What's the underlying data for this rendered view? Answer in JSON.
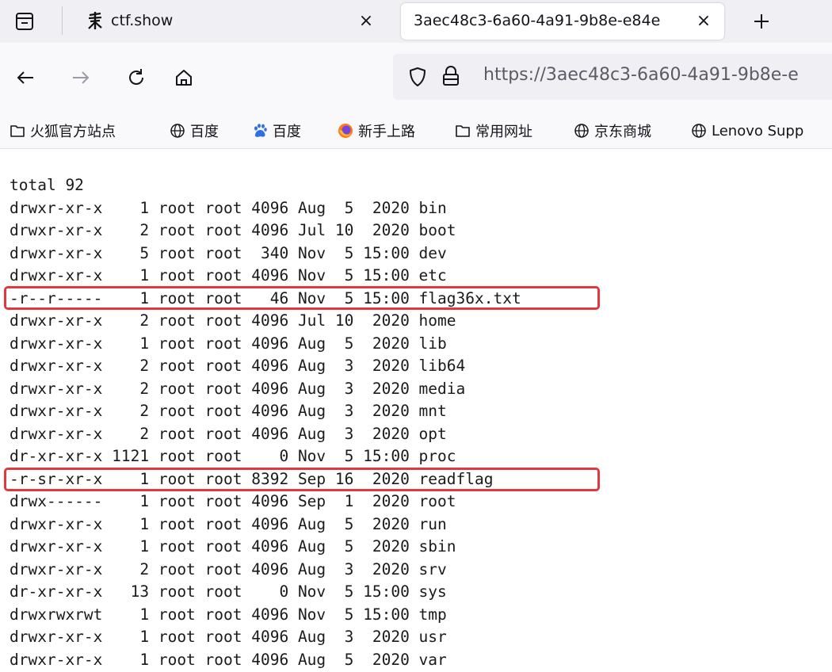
{
  "colors": {
    "tabstrip_bg": "#f0f0f4",
    "toolbar_bg": "#f9f9fb",
    "urlbar_bg": "#f0f0f4",
    "highlight_border": "#e0383e",
    "text": "#15141a",
    "url_text": "#5b5b66"
  },
  "tabs": [
    {
      "title": "ctf.show",
      "active": false,
      "close_glyph": "×",
      "favicon": "ctfshow-logo-icon"
    },
    {
      "title": "3aec48c3-6a60-4a91-9b8e-e84e",
      "active": true,
      "close_glyph": "×"
    }
  ],
  "tabstrip": {
    "new_tab_icon": "plus-icon",
    "list_tabs_icon": "tab-list-icon"
  },
  "navbar": {
    "icons": [
      "back-arrow-icon",
      "forward-arrow-icon",
      "reload-icon",
      "home-icon"
    ],
    "url": "https://3aec48c3-6a60-4a91-9b8e-e",
    "url_icons": [
      "shield-icon",
      "lock-icon"
    ]
  },
  "bookmarks": [
    {
      "label": "火狐官方站点",
      "icon": "folder-icon"
    },
    {
      "label": "百度",
      "icon": "globe-icon"
    },
    {
      "label": "百度",
      "icon": "baidu-paw-icon"
    },
    {
      "label": "新手上路",
      "icon": "firefox-icon"
    },
    {
      "label": "常用网址",
      "icon": "folder-icon"
    },
    {
      "label": "京东商城",
      "icon": "globe-icon"
    },
    {
      "label": "Lenovo Supp",
      "icon": "globe-icon"
    }
  ],
  "listing": {
    "lines": [
      "total 92",
      "drwxr-xr-x    1 root root 4096 Aug  5  2020 bin",
      "drwxr-xr-x    2 root root 4096 Jul 10  2020 boot",
      "drwxr-xr-x    5 root root  340 Nov  5 15:00 dev",
      "drwxr-xr-x    1 root root 4096 Nov  5 15:00 etc",
      "-r--r-----    1 root root   46 Nov  5 15:00 flag36x.txt",
      "drwxr-xr-x    2 root root 4096 Jul 10  2020 home",
      "drwxr-xr-x    1 root root 4096 Aug  5  2020 lib",
      "drwxr-xr-x    2 root root 4096 Aug  3  2020 lib64",
      "drwxr-xr-x    2 root root 4096 Aug  3  2020 media",
      "drwxr-xr-x    2 root root 4096 Aug  3  2020 mnt",
      "drwxr-xr-x    2 root root 4096 Aug  3  2020 opt",
      "dr-xr-xr-x 1121 root root    0 Nov  5 15:00 proc",
      "-r-sr-xr-x    1 root root 8392 Sep 16  2020 readflag",
      "drwx------    1 root root 4096 Sep  1  2020 root",
      "drwxr-xr-x    1 root root 4096 Aug  5  2020 run",
      "drwxr-xr-x    1 root root 4096 Aug  5  2020 sbin",
      "drwxr-xr-x    2 root root 4096 Aug  3  2020 srv",
      "dr-xr-xr-x   13 root root    0 Nov  5 15:00 sys",
      "drwxrwxrwt    1 root root 4096 Nov  5 15:00 tmp",
      "drwxr-xr-x    1 root root 4096 Aug  3  2020 usr",
      "drwxr-xr-x    1 root root 4096 Aug  5  2020 var"
    ],
    "highlighted_entries": [
      "flag36x.txt",
      "readflag"
    ]
  }
}
